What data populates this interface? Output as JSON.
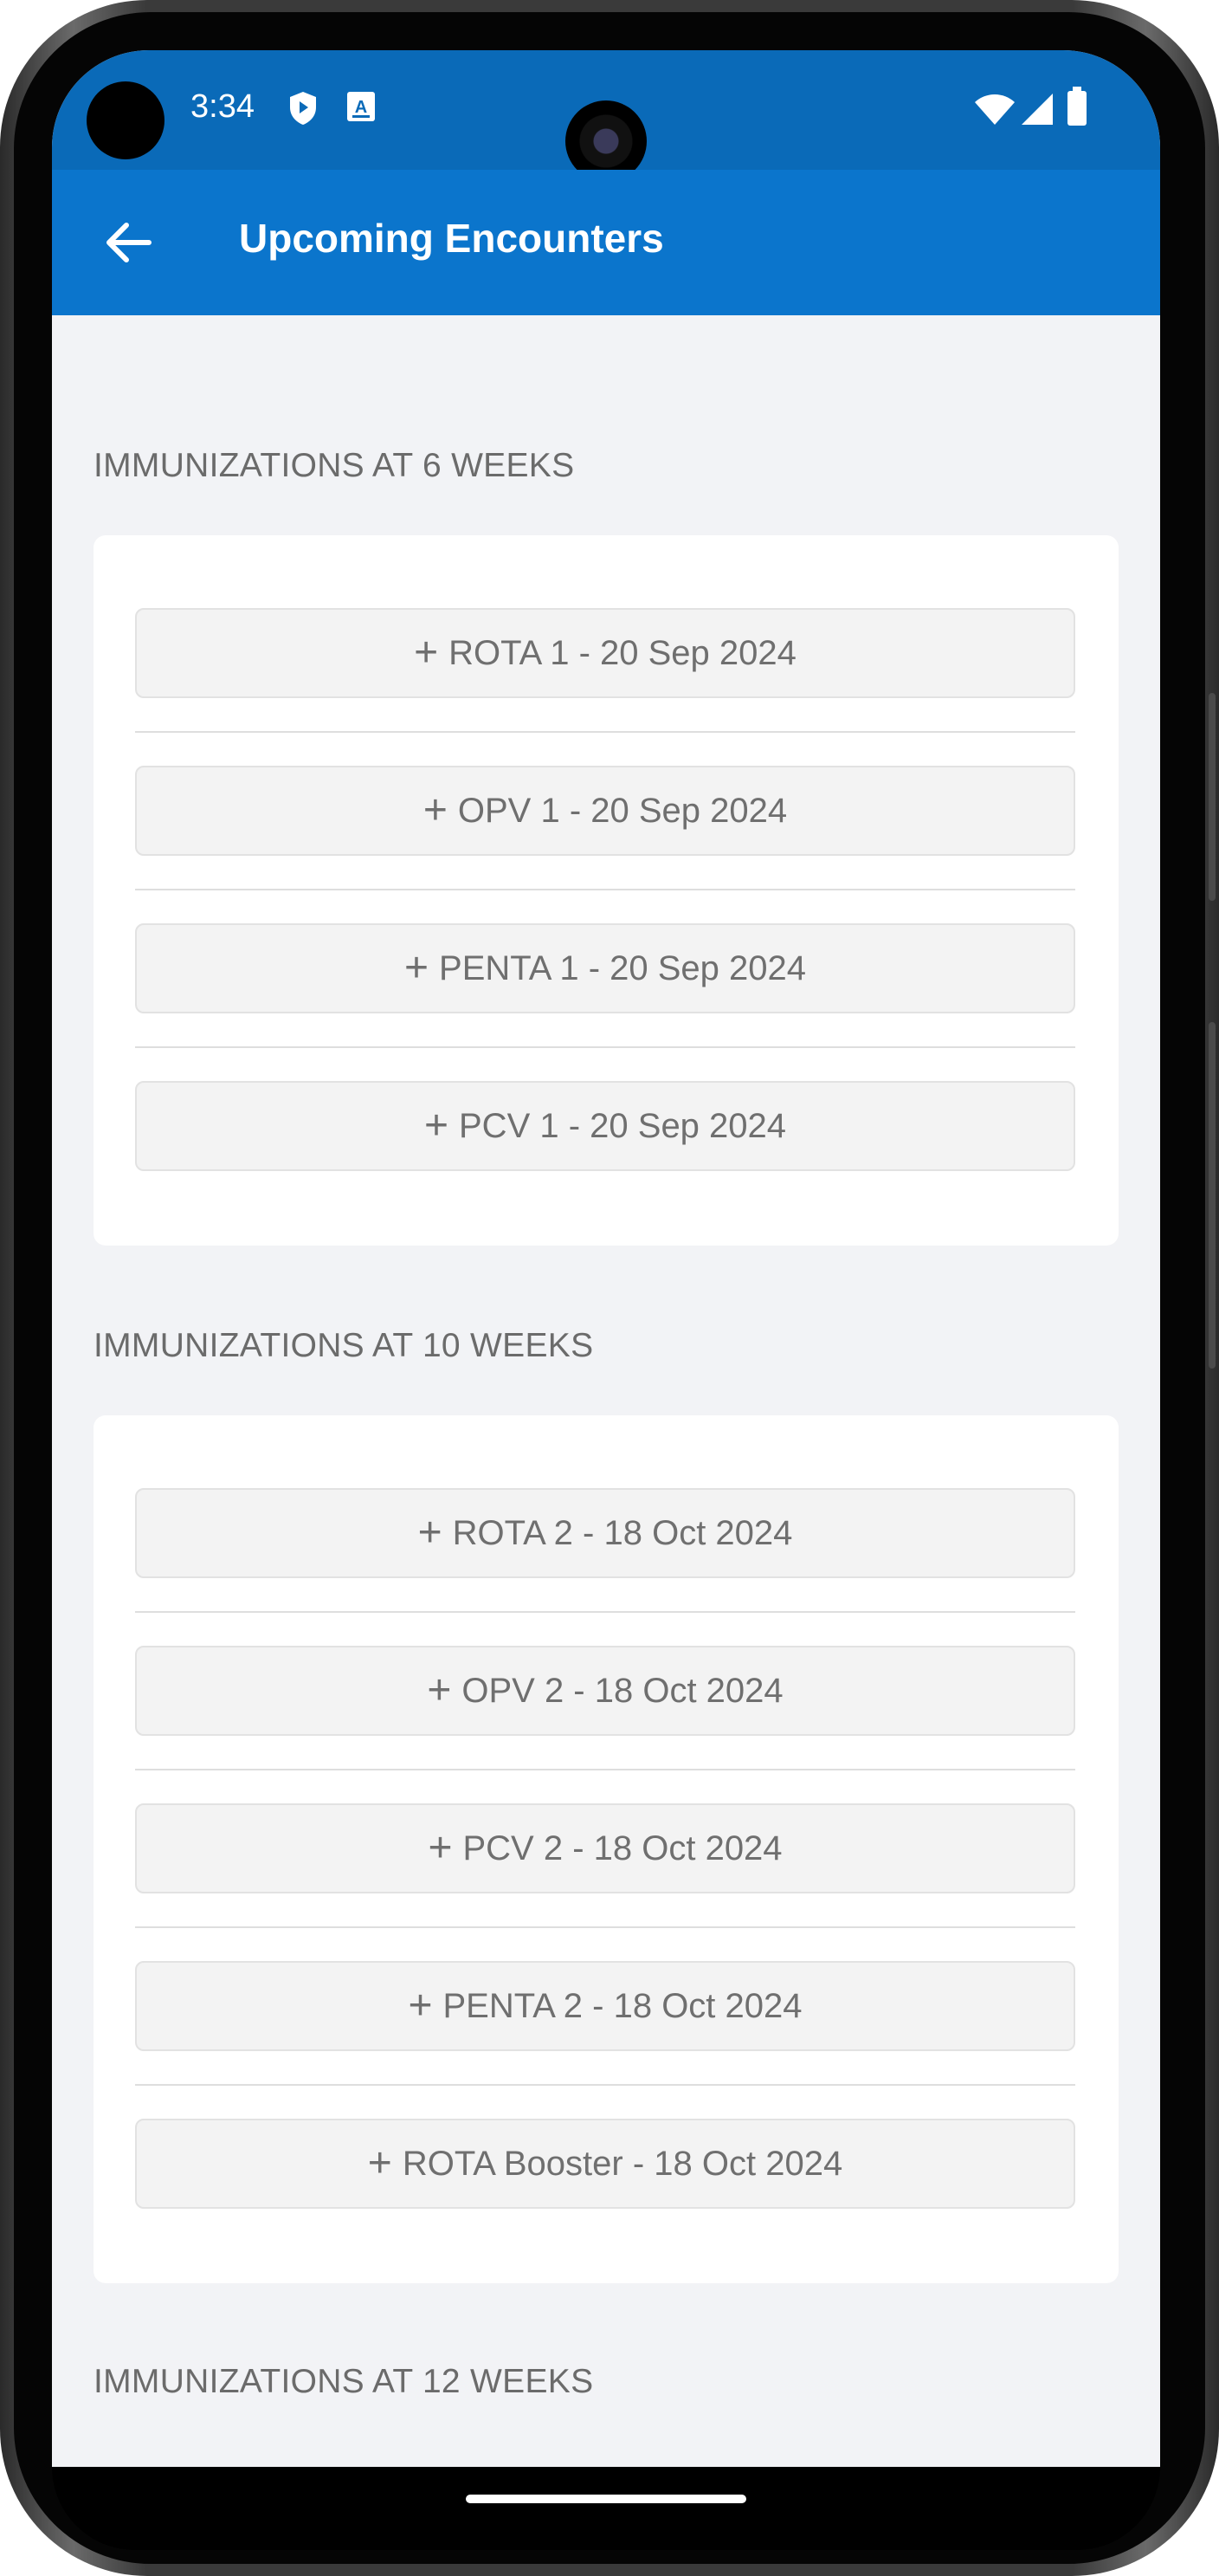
{
  "status_bar": {
    "time": "3:34",
    "icons": [
      "shield-play-icon",
      "translate-icon",
      "wifi-icon",
      "signal-icon",
      "battery-icon"
    ]
  },
  "app_bar": {
    "title": "Upcoming Encounters",
    "background_color": "#0b75cc"
  },
  "sections": [
    {
      "title": "IMMUNIZATIONS AT 6 WEEKS",
      "encounters": [
        "ROTA 1 - 20 Sep 2024",
        "OPV 1 - 20 Sep 2024",
        "PENTA 1 - 20 Sep 2024",
        "PCV 1 - 20 Sep 2024"
      ]
    },
    {
      "title": "IMMUNIZATIONS AT 10 WEEKS",
      "encounters": [
        "ROTA 2 - 18 Oct 2024",
        "OPV 2 - 18 Oct 2024",
        "PCV 2 - 18 Oct 2024",
        "PENTA 2 - 18 Oct 2024",
        "ROTA Booster - 18 Oct 2024"
      ]
    },
    {
      "title": "IMMUNIZATIONS AT 12 WEEKS",
      "encounters": []
    }
  ]
}
